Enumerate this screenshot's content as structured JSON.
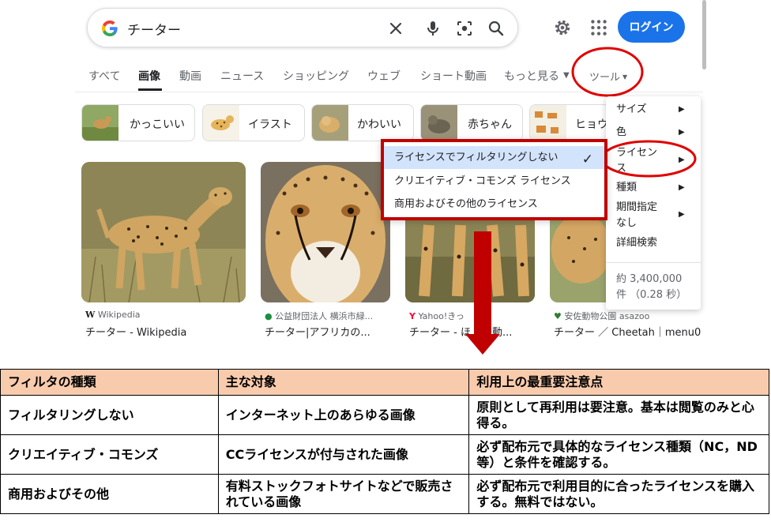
{
  "search": {
    "query": "チーター"
  },
  "header": {
    "login_label": "ログイン"
  },
  "nav": {
    "tabs": [
      "すべて",
      "画像",
      "動画",
      "ニュース",
      "ショッピング",
      "ウェブ",
      "ショート動画",
      "もっと見る",
      "ツール"
    ],
    "active_tab": "画像"
  },
  "chips": [
    "かっこいい",
    "イラスト",
    "かわいい",
    "赤ちゃん",
    "ヒョウ"
  ],
  "results": [
    {
      "source": "Wikipedia",
      "caption": "チーター - Wikipedia"
    },
    {
      "source": "公益財団法人 横浜市緑...",
      "caption": "チーター|アフリカの..."
    },
    {
      "source": "Yahoo!きっ",
      "caption": "チーター - ほ"
    },
    {
      "source": "安佐動物公園 asazoo",
      "caption": "チーター ／ Cheetah｜menu0"
    }
  ],
  "results_extra": {
    "caption3_tail": "・動..."
  },
  "tools_menu": {
    "items": [
      "サイズ",
      "色",
      "ライセン\nス",
      "種類",
      "期間指定\nなし",
      "詳細検索"
    ],
    "result_count": "約 3,400,000\n件 （0.28 秒）"
  },
  "license_menu": {
    "options": [
      "ライセンスでフィルタリングしない",
      "クリエイティブ・コモンズ ライセンス",
      "商用およびその他のライセンス"
    ],
    "selected_index": 0
  },
  "table": {
    "headers": [
      "フィルタの種類",
      "主な対象",
      "利用上の最重要注意点"
    ],
    "rows": [
      [
        "フィルタリングしない",
        "インターネット上のあらゆる画像",
        "原則として再利用は要注意。基本は閲覧のみと心得る。"
      ],
      [
        "クリエイティブ・コモンズ",
        "CCライセンスが付与された画像",
        "必ず配布元で具体的なライセンス種類（NC，ND等）と条件を確認する。"
      ],
      [
        "商用およびその他",
        "有料ストックフォトサイトなどで販売されている画像",
        "必ず配布元で利用目的に合ったライセンスを購入する。無料ではない。"
      ]
    ]
  },
  "colors": {
    "accent_blue": "#1a73e8",
    "annotation_red": "#c00000",
    "table_header": "#f8cbad",
    "selected_option": "#d2e3fc"
  }
}
